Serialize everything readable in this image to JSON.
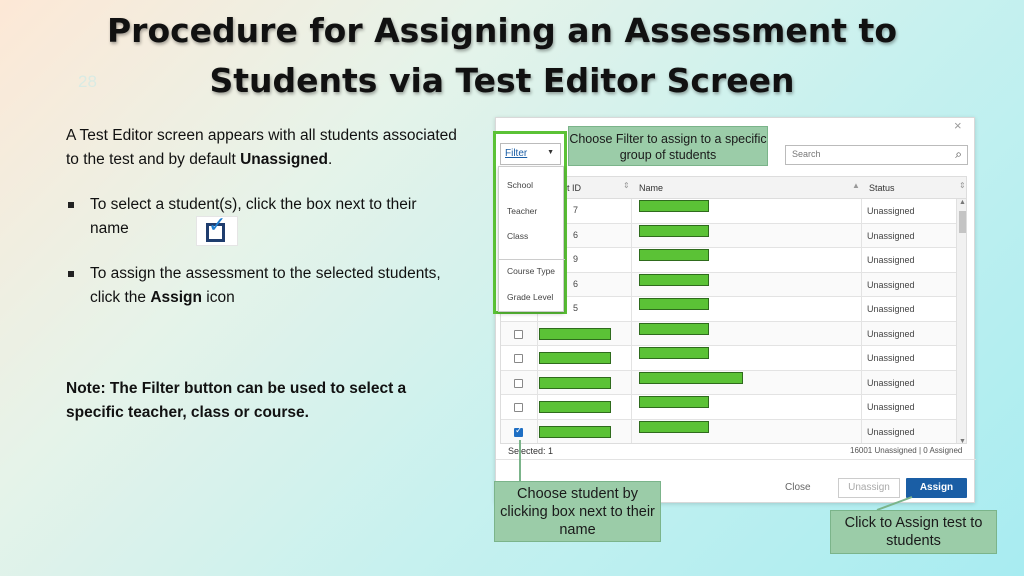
{
  "slide": {
    "title_line1": "Procedure for Assigning an Assessment to",
    "title_line2": "Students via Test Editor Screen",
    "number": "28"
  },
  "instructions": {
    "intro_part1": "A Test Editor screen appears with all students associated to the test and by default ",
    "intro_bold": "Unassigned",
    "intro_end": ".",
    "bullet1": "To select a student(s), click the box next to their name",
    "bullet2_part1": "To assign the assessment to the selected students, click the ",
    "bullet2_bold": "Assign",
    "bullet2_end": " icon",
    "note": "Note:  The Filter button can be used to select a specific teacher, class or course."
  },
  "dialog": {
    "close_glyph": "×",
    "search_placeholder": "Search",
    "filter_label": "Filter",
    "filter_options": [
      "School",
      "Teacher",
      "Class",
      "Course Type",
      "Grade Level"
    ],
    "columns": {
      "id": "t ID",
      "name": "Name",
      "status": "Status"
    },
    "rows": [
      {
        "id_frag": "7",
        "status": "Unassigned",
        "checked": false
      },
      {
        "id_frag": "6",
        "status": "Unassigned",
        "checked": false
      },
      {
        "id_frag": "9",
        "status": "Unassigned",
        "checked": false
      },
      {
        "id_frag": "6",
        "status": "Unassigned",
        "checked": false
      },
      {
        "id_frag": "5",
        "status": "Unassigned",
        "checked": false
      },
      {
        "id_frag": "",
        "status": "Unassigned",
        "checked": false
      },
      {
        "id_frag": "",
        "status": "Unassigned",
        "checked": false
      },
      {
        "id_frag": "",
        "status": "Unassigned",
        "checked": false
      },
      {
        "id_frag": "",
        "status": "Unassigned",
        "checked": false
      },
      {
        "id_frag": "",
        "status": "Unassigned",
        "checked": true
      }
    ],
    "selected_label": "Selected: 1",
    "counts": "16001 Unassigned | 0 Assigned",
    "buttons": {
      "close": "Close",
      "unassign": "Unassign",
      "assign": "Assign"
    }
  },
  "callouts": {
    "filter": "Choose Filter to assign to a specific group of students",
    "student": "Choose student by clicking box next to their name",
    "assign": "Click to Assign test to students"
  },
  "colors": {
    "highlight": "#5bc236",
    "callout": "#9bcca8",
    "assign": "#1a5ea5"
  }
}
